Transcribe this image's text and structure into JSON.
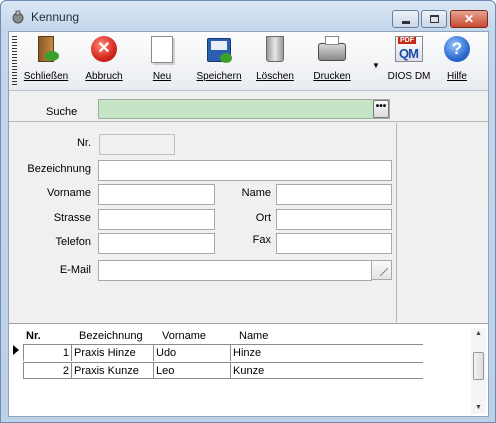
{
  "window": {
    "title": "Kennung",
    "close_symbol": "✕"
  },
  "toolbar": {
    "buttons": [
      {
        "id": "schliessen",
        "label": "Schließen",
        "icon": "exit-door-icon"
      },
      {
        "id": "abbruch",
        "label": "Abbruch",
        "icon": "cancel-icon"
      },
      {
        "id": "neu",
        "label": "Neu",
        "icon": "new-document-icon"
      },
      {
        "id": "speichern",
        "label": "Speichern",
        "icon": "save-icon"
      },
      {
        "id": "loeschen",
        "label": "Löschen",
        "icon": "trash-icon"
      },
      {
        "id": "drucken",
        "label": "Drucken",
        "icon": "printer-icon"
      },
      {
        "id": "dios",
        "label": "DIOS DM",
        "icon": "dios-dm-icon"
      },
      {
        "id": "hilfe",
        "label": "Hilfe",
        "icon": "help-icon"
      }
    ],
    "dropdown_symbol": "▼",
    "cancel_symbol": "✕",
    "help_symbol": "?",
    "dios_badge": "PDF",
    "dios_logo": "QM"
  },
  "search": {
    "label": "Suche",
    "value": "",
    "button_label": "•••"
  },
  "form": {
    "nr_label": "Nr.",
    "nr_value": "",
    "bezeichnung_label": "Bezeichnung",
    "bezeichnung_value": "",
    "vorname_label": "Vorname",
    "vorname_value": "",
    "name_label": "Name",
    "name_value": "",
    "strasse_label": "Strasse",
    "strasse_value": "",
    "ort_label": "Ort",
    "ort_value": "",
    "telefon_label": "Telefon",
    "telefon_value": "",
    "fax_label": "Fax",
    "fax_value": "",
    "email_label": "E-Mail",
    "email_value": ""
  },
  "grid": {
    "columns": [
      "Nr.",
      "Bezeichnung",
      "Vorname",
      "Name"
    ],
    "rows": [
      {
        "nr": "1",
        "bezeichnung": "Praxis Hinze",
        "vorname": "Udo",
        "name": "Hinze"
      },
      {
        "nr": "2",
        "bezeichnung": "Praxis Kunze",
        "vorname": "Leo",
        "name": "Kunze"
      }
    ],
    "scroll_up": "▲",
    "scroll_down": "▼"
  }
}
